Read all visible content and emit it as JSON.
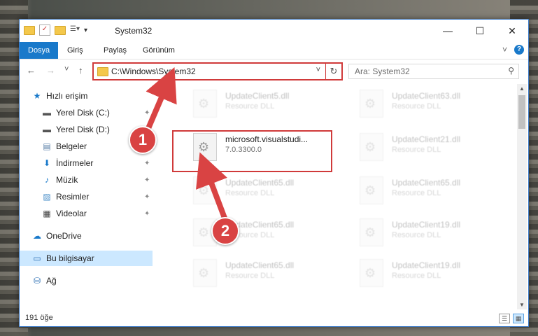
{
  "window": {
    "title": "System32",
    "controls": {
      "minimize": "—",
      "maximize": "☐",
      "close": "✕"
    }
  },
  "ribbon": {
    "tabs": [
      {
        "label": "Dosya",
        "active": true
      },
      {
        "label": "Giriş",
        "active": false
      },
      {
        "label": "Paylaş",
        "active": false
      },
      {
        "label": "Görünüm",
        "active": false
      }
    ],
    "expand_glyph": "˅",
    "help_glyph": "?"
  },
  "navigation": {
    "back_glyph": "←",
    "forward_glyph": "→",
    "recent_glyph": "˅",
    "up_glyph": "↑",
    "address": "C:\\Windows\\System32",
    "address_dropdown_glyph": "˅",
    "refresh_glyph": "↻",
    "search_placeholder": "Ara: System32",
    "search_glyph": "⚲"
  },
  "sidebar": {
    "items": [
      {
        "label": "Hızlı erişim",
        "icon": "star-icon",
        "glyph": "★",
        "pinned": false
      },
      {
        "label": "Yerel Disk (C:)",
        "icon": "drive-icon",
        "glyph": "▬",
        "pinned": true
      },
      {
        "label": "Yerel Disk (D:)",
        "icon": "drive-icon",
        "glyph": "▬",
        "pinned": true
      },
      {
        "label": "Belgeler",
        "icon": "documents-icon",
        "glyph": "▤",
        "pinned": true
      },
      {
        "label": "İndirmeler",
        "icon": "downloads-icon",
        "glyph": "⬇",
        "pinned": true
      },
      {
        "label": "Müzik",
        "icon": "music-icon",
        "glyph": "♪",
        "pinned": true
      },
      {
        "label": "Resimler",
        "icon": "pictures-icon",
        "glyph": "▨",
        "pinned": true
      },
      {
        "label": "Videolar",
        "icon": "videos-icon",
        "glyph": "▦",
        "pinned": true
      },
      {
        "label": "OneDrive",
        "icon": "cloud-icon",
        "glyph": "☁",
        "pinned": false
      },
      {
        "label": "Bu bilgisayar",
        "icon": "computer-icon",
        "glyph": "▭",
        "pinned": false,
        "selected": true
      },
      {
        "label": "Ağ",
        "icon": "network-icon",
        "glyph": "⛁",
        "pinned": false
      }
    ],
    "pin_glyph": "✦"
  },
  "files": {
    "left_column": [
      {
        "name": "UpdateClient5.dll",
        "type": "Resource DLL",
        "faded": true
      },
      {
        "name": "microsoft.visualstudi...",
        "type": "7.0.3300.0",
        "faded": false
      },
      {
        "name": "UpdateClient65.dll",
        "type": "Resource DLL",
        "faded": true
      },
      {
        "name": "UpdateClient65.dll",
        "type": "Resource DLL",
        "faded": true
      },
      {
        "name": "UpdateClient65.dll",
        "type": "Resource DLL",
        "faded": true
      }
    ],
    "right_column": [
      {
        "name": "UpdateClient63.dll",
        "type": "Resource DLL",
        "faded": true
      },
      {
        "name": "UpdateClient21.dll",
        "type": "Resource DLL",
        "faded": true
      },
      {
        "name": "UpdateClient65.dll",
        "type": "Resource DLL",
        "faded": true
      },
      {
        "name": "UpdateClient19.dll",
        "type": "Resource DLL",
        "faded": true
      },
      {
        "name": "UpdateClient19.dll",
        "type": "Resource DLL",
        "faded": true
      }
    ]
  },
  "status_bar": {
    "item_count": "191 öğe"
  },
  "callouts": [
    {
      "number": "1"
    },
    {
      "number": "2"
    }
  ],
  "colors": {
    "accent": "#1979ca",
    "highlight": "#d03a3a"
  }
}
